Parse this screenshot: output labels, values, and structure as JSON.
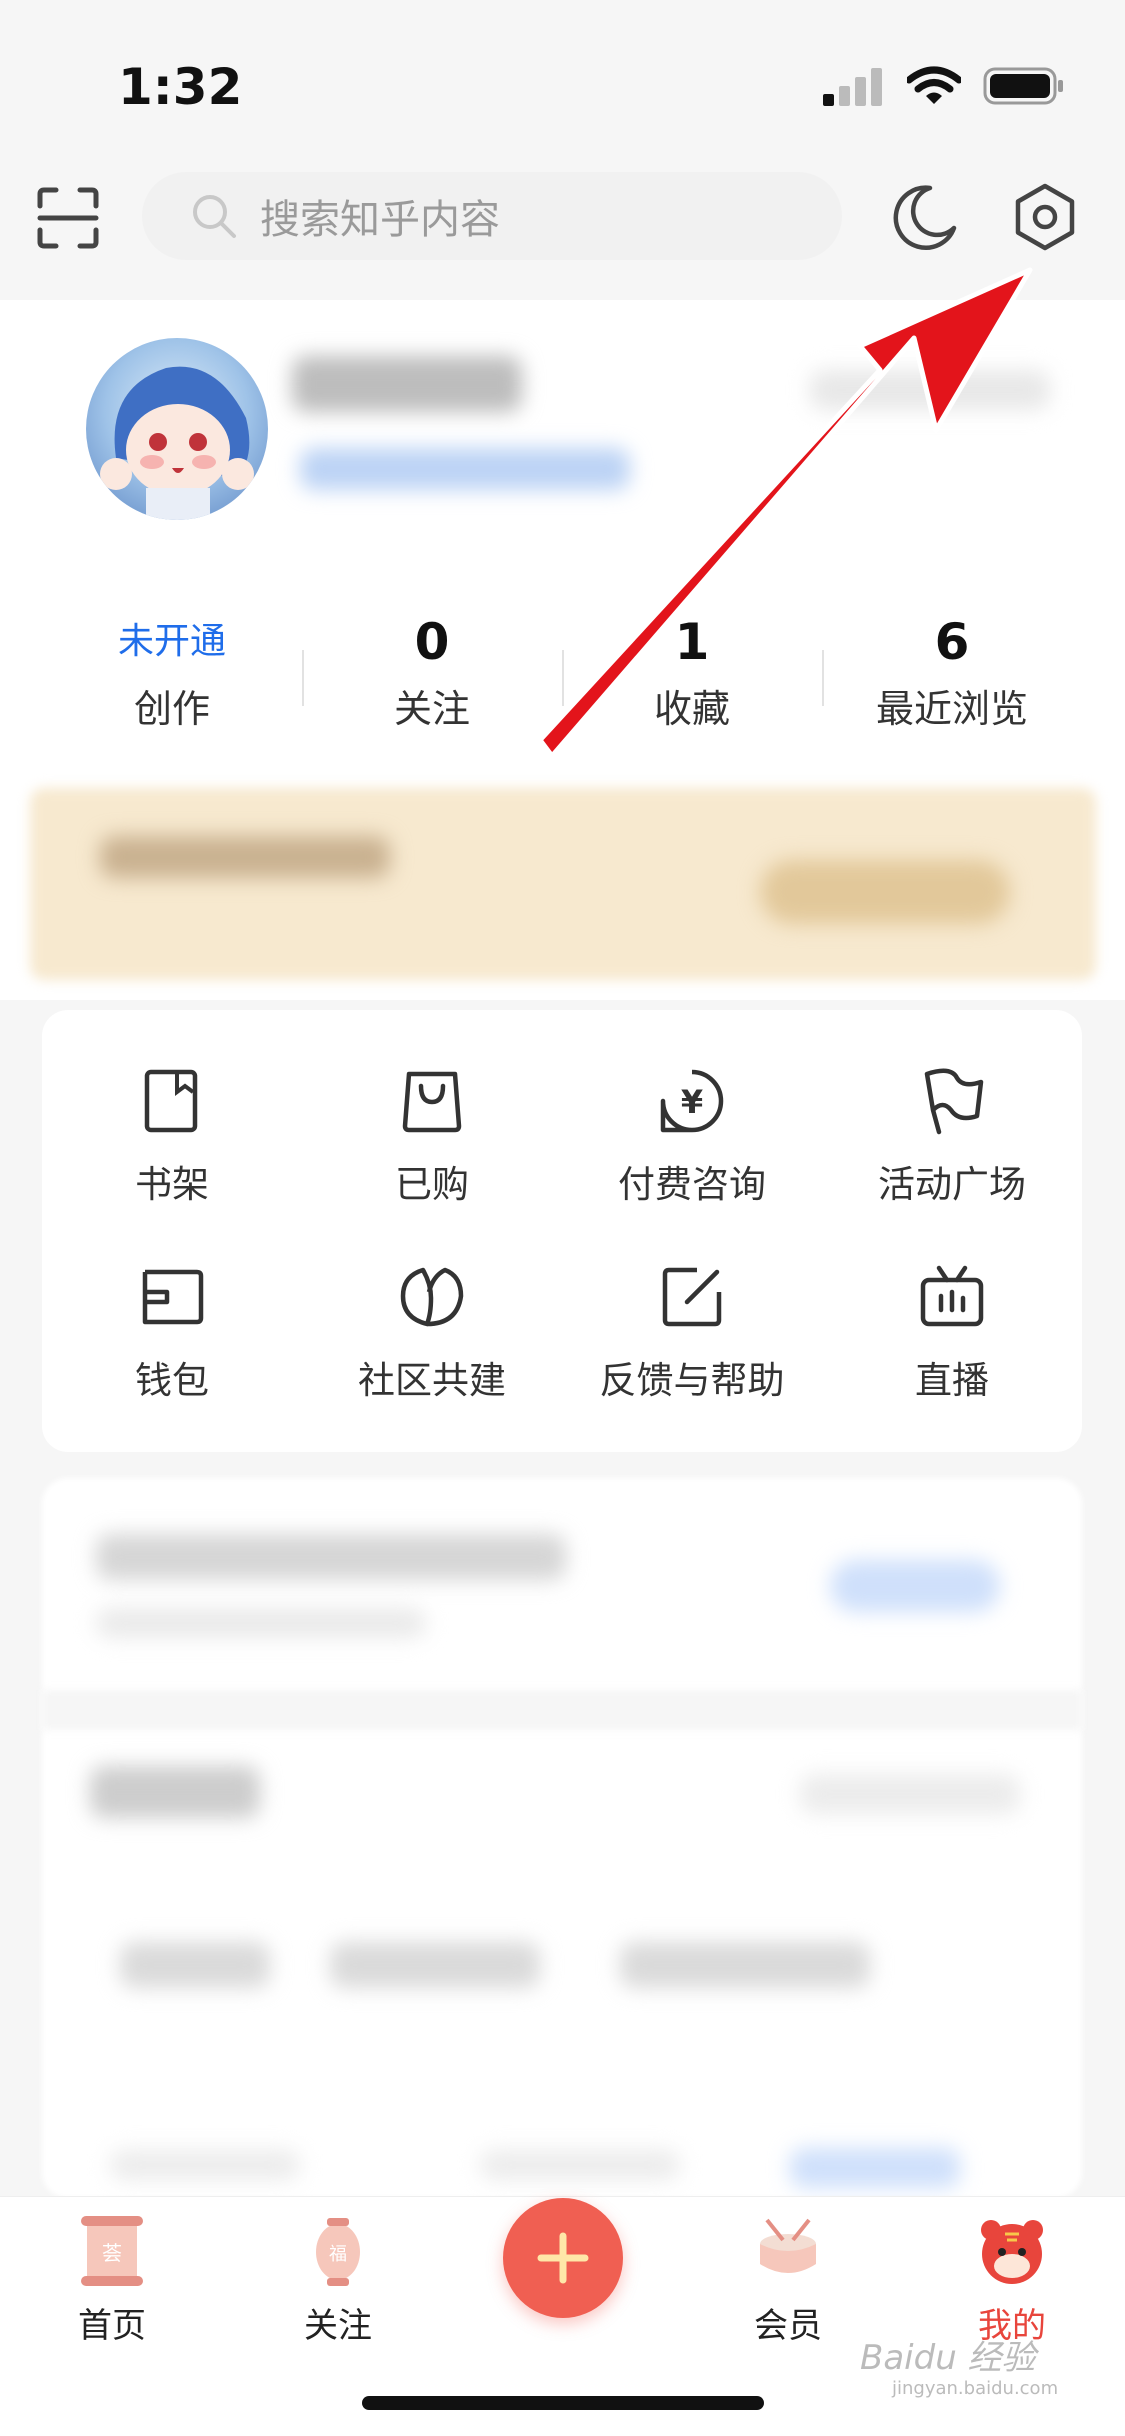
{
  "status_bar": {
    "time": "1:32"
  },
  "search": {
    "placeholder": "搜索知乎内容"
  },
  "stats": [
    {
      "value": "未开通",
      "label": "创作"
    },
    {
      "value": "0",
      "label": "关注"
    },
    {
      "value": "1",
      "label": "收藏"
    },
    {
      "value": "6",
      "label": "最近浏览"
    }
  ],
  "shortcuts": [
    {
      "label": "书架",
      "icon": "bookshelf-icon"
    },
    {
      "label": "已购",
      "icon": "shopping-bag-icon"
    },
    {
      "label": "付费咨询",
      "icon": "paid-consult-icon"
    },
    {
      "label": "活动广场",
      "icon": "flag-icon"
    },
    {
      "label": "钱包",
      "icon": "wallet-icon"
    },
    {
      "label": "社区共建",
      "icon": "leaf-icon"
    },
    {
      "label": "反馈与帮助",
      "icon": "edit-icon"
    },
    {
      "label": "直播",
      "icon": "tv-icon"
    }
  ],
  "tabbar": {
    "items": [
      {
        "label": "首页",
        "icon": "scroll-icon"
      },
      {
        "label": "关注",
        "icon": "lantern-icon"
      },
      {
        "label": "会员",
        "icon": "drum-icon"
      },
      {
        "label": "我的",
        "icon": "tiger-icon"
      }
    ],
    "active_color": "#e8453c"
  },
  "watermark": {
    "text": "Baidu 经验",
    "sub": "jingyan.baidu.com"
  },
  "colors": {
    "accent_blue": "#1f6dea",
    "fab_red": "#f05f52",
    "annotation_arrow": "#e3141b"
  }
}
